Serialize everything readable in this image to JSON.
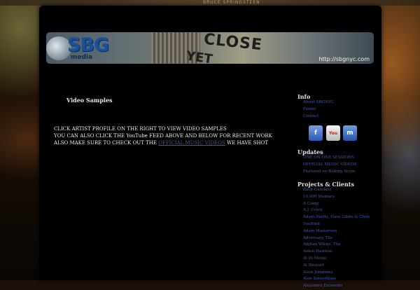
{
  "page": {
    "background_accent": "#c47a2e",
    "panel_color": "#000000",
    "link_color": "#3f5fa8"
  },
  "background": {
    "top_name": "BRUCE SPRINGSTEEN"
  },
  "banner": {
    "logo_main": "SBG",
    "logo_sub": "media",
    "word_1": "CLOSE",
    "word_2": "YET",
    "url": "http://sbgnyc.com"
  },
  "main": {
    "title": "Video Samples",
    "line_1": "CLICK ARTIST PROFILE ON THE RIGHT TO VIEW VIDEO SAMPLES",
    "line_2": "YOU CAN ALSO CLICK THE YouTube FEED ABOVE AND BELOW FOR RECENT WORK",
    "line_3_before": "ALSO MAKE SURE TO CHECK OUT THE ",
    "line_3_link": "OFFICIAL MUSIC VIDEOS",
    "line_3_after": " WE HAVE SHOT"
  },
  "sidebar": {
    "info_heading": "Info",
    "info_links": [
      "About SBGNYC",
      "Footer",
      "Contact"
    ],
    "social": [
      {
        "icon": "facebook-icon",
        "label": "f"
      },
      {
        "icon": "youtube-icon",
        "label": "You"
      },
      {
        "icon": "myspace-icon",
        "label": "m"
      }
    ],
    "updates_heading": "Updates",
    "updates_links": [
      "ONE ON ONE SESSIONS",
      "OFFICIAL MUSIC VIDEOS",
      "Featured on Rolling Stone"
    ],
    "projects_heading": "Projects & Clients",
    "projects_links": [
      "Zach Gutekiss",
      "10,000 Maniacs",
      "A Camp",
      "A.J. Croce",
      "Adam Duritz, Dave Gibbs & Chris",
      "Seefried",
      "Adam Masterson",
      "Adversary, The",
      "Afghan Whigs, The",
      "Aiden Hawken",
      "Al Di Meola",
      "Al Stewart",
      "Alain Johannes",
      "Alan Semerdjian",
      "Alejandro Escovedo"
    ]
  }
}
